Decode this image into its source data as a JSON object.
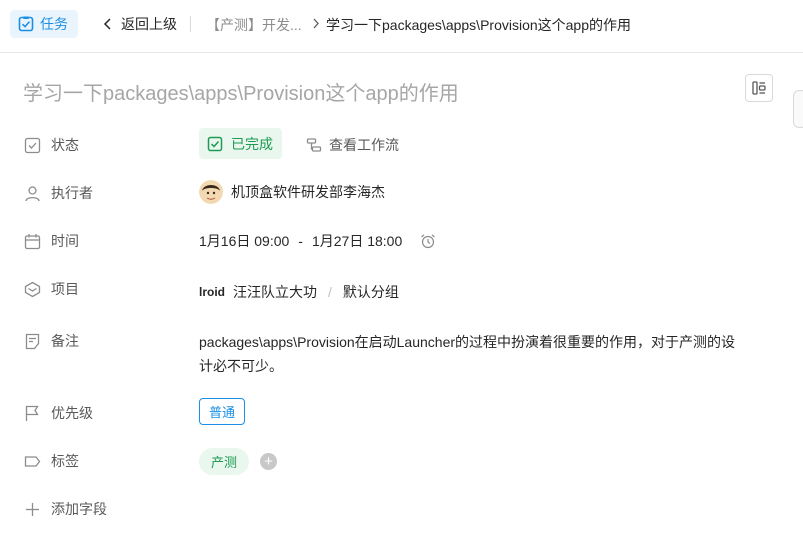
{
  "header": {
    "app_tab_label": "任务",
    "back_label": "返回上级",
    "breadcrumb_parent": "【产测】开发...",
    "breadcrumb_current": "学习一下packages\\apps\\Provision这个app的作用"
  },
  "task": {
    "title": "学习一下packages\\apps\\Provision这个app的作用"
  },
  "fields": {
    "status_label": "状态",
    "status_value": "已完成",
    "workflow_label": "查看工作流",
    "assignee_label": "执行者",
    "assignee_value": "机顶盒软件研发部李海杰",
    "time_label": "时间",
    "time_start": "1月16日 09:00",
    "time_separator": "-",
    "time_end": "1月27日 18:00",
    "project_label": "项目",
    "project_logo_text": "lroid",
    "project_name": "汪汪队立大功",
    "project_separator": "/",
    "project_group": "默认分组",
    "note_label": "备注",
    "note_text": "packages\\apps\\Provision在启动Launcher的过程中扮演着很重要的作用，对于产测的设计必不可少。",
    "priority_label": "优先级",
    "priority_value": "普通",
    "tags_label": "标签",
    "tags": [
      "产测"
    ],
    "tag_add_symbol": "+",
    "add_field_label": "添加字段"
  },
  "colors": {
    "accent": "#1b8fe6",
    "success": "#1d9b52",
    "success_bg": "#e9f7ee"
  }
}
